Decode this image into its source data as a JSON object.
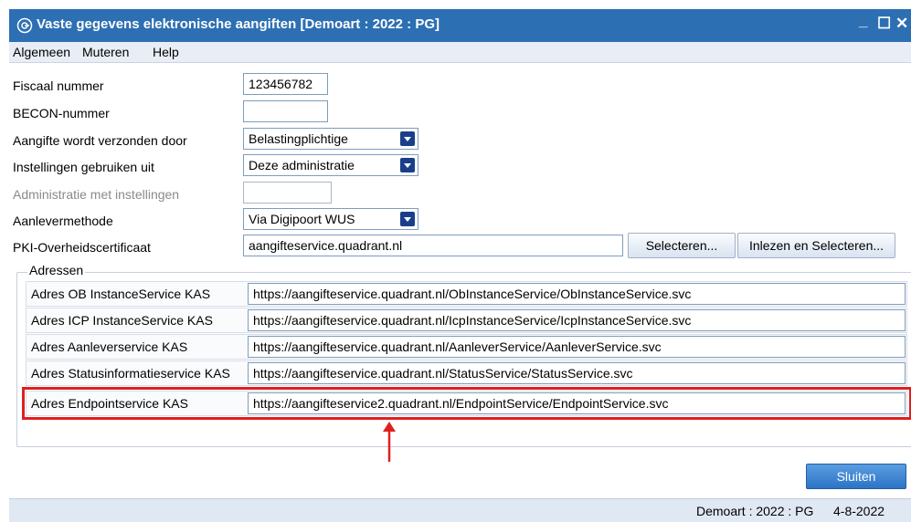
{
  "window": {
    "title": "Vaste gegevens elektronische aangiften  [Demoart : 2022 : PG]",
    "minimize": "_",
    "maximize": "☐",
    "close": "✕"
  },
  "menu": [
    "Algemeen",
    "Muteren",
    "Help"
  ],
  "form": {
    "fiscaal_label": "Fiscaal nummer",
    "fiscaal_value": "123456782",
    "becon_label": "BECON-nummer",
    "becon_value": "",
    "verzonden_label": "Aangifte wordt verzonden door",
    "verzonden_value": "Belastingplichtige",
    "instellingen_label": "Instellingen gebruiken uit",
    "instellingen_value": "Deze administratie",
    "admin_label": "Administratie met instellingen",
    "admin_value": "",
    "methode_label": "Aanlevermethode",
    "methode_value": "Via Digipoort WUS",
    "pki_label": "PKI-Overheidscertificaat",
    "pki_value": "aangifteservice.quadrant.nl",
    "select_button": "Selecteren...",
    "read_select_button": "Inlezen en Selecteren..."
  },
  "addresses": {
    "legend": "Adressen",
    "rows": [
      {
        "label": "Adres OB InstanceService KAS",
        "value": "https://aangifteservice.quadrant.nl/ObInstanceService/ObInstanceService.svc"
      },
      {
        "label": "Adres ICP InstanceService KAS",
        "value": "https://aangifteservice.quadrant.nl/IcpInstanceService/IcpInstanceService.svc"
      },
      {
        "label": "Adres Aanleverservice KAS",
        "value": "https://aangifteservice.quadrant.nl/AanleverService/AanleverService.svc"
      },
      {
        "label": "Adres Statusinformatieservice KAS",
        "value": "https://aangifteservice.quadrant.nl/StatusService/StatusService.svc"
      },
      {
        "label": "Adres Endpointservice KAS",
        "value": "https://aangifteservice2.quadrant.nl/EndpointService/EndpointService.svc"
      }
    ]
  },
  "close_button": "Sluiten",
  "status": {
    "context": "Demoart : 2022 : PG",
    "date": "4-8-2022"
  },
  "colors": {
    "titlebar": "#2d6fb3",
    "highlight": "#e01f1f",
    "primary_button": "#2c74c6"
  }
}
